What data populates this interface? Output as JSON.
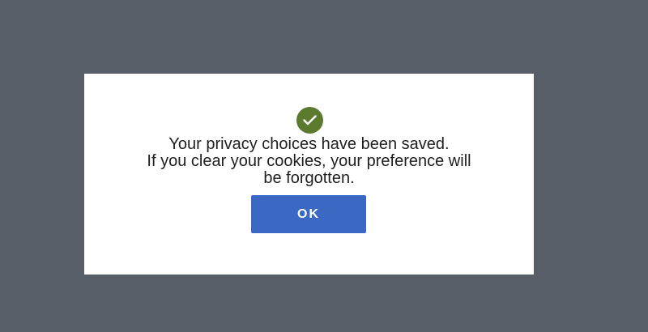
{
  "dialog": {
    "icon": "checkmark-circle-icon",
    "icon_color": "#5c7a2e",
    "message_lines": [
      "Your privacy choices have been saved.",
      "If you clear your cookies, your preference will",
      "be forgotten."
    ],
    "ok_label": "OK",
    "button_color": "#3b68c2"
  },
  "backdrop_color": "#585e67"
}
